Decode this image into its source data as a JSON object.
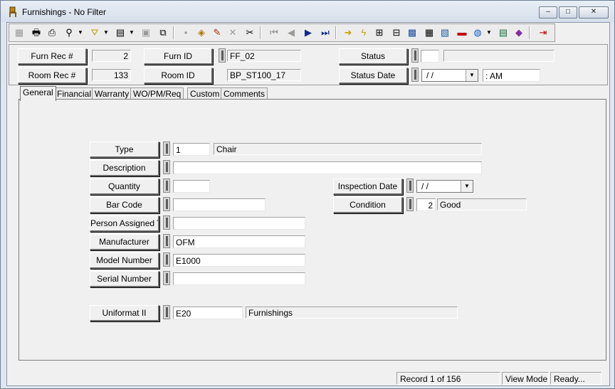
{
  "window": {
    "title": "Furnishings - No Filter",
    "min_glyph": "–",
    "max_glyph": "□",
    "close_glyph": "✕"
  },
  "toolbar": {
    "icons": [
      "grid-view-icon",
      "print-icon",
      "print-preview-icon",
      "find-icon",
      "filter-icon",
      "report-icon",
      "new-record-icon",
      "copy-record-icon",
      "save-icon",
      "attach-icon",
      "edit-icon",
      "delete-icon",
      "cut-icon",
      "first-record-icon",
      "previous-record-icon",
      "next-record-icon",
      "last-record-icon",
      "goto-icon",
      "refresh-icon",
      "lookup-icon",
      "tree-icon",
      "picture-icon",
      "calculator-icon",
      "map-icon",
      "tag-icon",
      "web-icon",
      "spreadsheet-icon",
      "notes-icon",
      "exit-icon"
    ]
  },
  "header": {
    "furn_rec_label": "Furn Rec #",
    "furn_rec_value": "2",
    "room_rec_label": "Room Rec #",
    "room_rec_value": "133",
    "furn_id_label": "Furn ID",
    "furn_id_value": "FF_02",
    "room_id_label": "Room ID",
    "room_id_value": "BP_ST100_17",
    "status_label": "Status",
    "status_code": "",
    "status_desc": "",
    "status_date_label": "Status Date",
    "status_date_value": " /  /",
    "status_time_value": "  :   AM"
  },
  "tabs": [
    {
      "label": "General",
      "active": true
    },
    {
      "label": "Financial",
      "active": false
    },
    {
      "label": "Warranty",
      "active": false
    },
    {
      "label": "WO/PM/Req",
      "active": false
    },
    {
      "label": "Custom",
      "active": false
    },
    {
      "label": "Comments",
      "active": false
    }
  ],
  "general": {
    "type_label": "Type",
    "type_code": "1",
    "type_desc": "Chair",
    "description_label": "Description",
    "description_value": "",
    "quantity_label": "Quantity",
    "quantity_value": "",
    "barcode_label": "Bar Code",
    "barcode_value": "",
    "person_label": "Person Assigned To",
    "person_value": "",
    "manufacturer_label": "Manufacturer",
    "manufacturer_value": "OFM",
    "model_label": "Model Number",
    "model_value": "E1000",
    "serial_label": "Serial Number",
    "serial_value": "",
    "inspection_label": "Inspection Date",
    "inspection_value": " /  /",
    "condition_label": "Condition",
    "condition_code": "2",
    "condition_desc": "Good",
    "uniformat_label": "Uniformat II",
    "uniformat_code": "E20",
    "uniformat_desc": "Furnishings"
  },
  "statusbar": {
    "record": "Record 1 of 156",
    "mode": "View Mode",
    "state": "Ready..."
  }
}
